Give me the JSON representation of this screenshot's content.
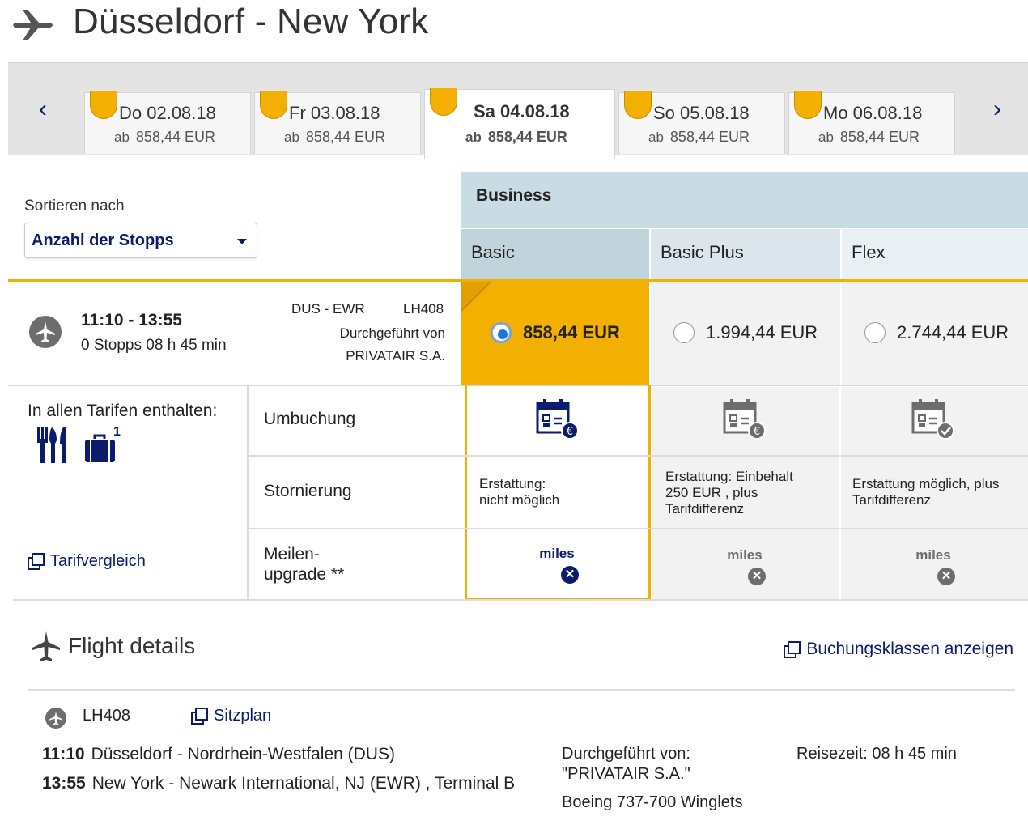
{
  "header": {
    "title": "Düsseldorf - New York"
  },
  "date_tabs": [
    {
      "date": "Do 02.08.18",
      "ab": "ab",
      "price": "858,44 EUR",
      "selected": false
    },
    {
      "date": "Fr 03.08.18",
      "ab": "ab",
      "price": "858,44 EUR",
      "selected": false
    },
    {
      "date": "Sa 04.08.18",
      "ab": "ab",
      "price": "858,44 EUR",
      "selected": true
    },
    {
      "date": "So 05.08.18",
      "ab": "ab",
      "price": "858,44 EUR",
      "selected": false
    },
    {
      "date": "Mo 06.08.18",
      "ab": "ab",
      "price": "858,44 EUR",
      "selected": false
    }
  ],
  "nav": {
    "prev": "‹",
    "next": "›"
  },
  "sort": {
    "label": "Sortieren nach",
    "value": "Anzahl der Stopps"
  },
  "cabin": {
    "name": "Business",
    "fares": [
      "Basic",
      "Basic Plus",
      "Flex"
    ]
  },
  "flight": {
    "times": "11:10 - 13:55",
    "stops_duration": "0 Stopps 08 h 45 min",
    "route": "DUS - EWR",
    "flight_number": "LH408",
    "operated_label": "Durchgeführt von",
    "operator": "PRIVATAIR S.A.",
    "prices": [
      {
        "fare": "Basic",
        "price": "858,44 EUR",
        "selected": true
      },
      {
        "fare": "Basic Plus",
        "price": "1.994,44 EUR",
        "selected": false
      },
      {
        "fare": "Flex",
        "price": "2.744,44 EUR",
        "selected": false
      }
    ]
  },
  "included": {
    "label": "In allen Tarifen enthalten:",
    "baggage_count": "1",
    "compare_link": "Tarifvergleich"
  },
  "conditions": {
    "rebooking_label": "Umbuchung",
    "cancellation_label": "Stornierung",
    "upgrade_label_line1": "Meilen-",
    "upgrade_label_line2": "upgrade **",
    "cancellation": [
      [
        "Erstattung:",
        "nicht möglich"
      ],
      [
        "Erstattung: Einbehalt",
        "250 EUR , plus",
        "Tarifdifferenz"
      ],
      [
        "Erstattung möglich, plus",
        "Tarifdifferenz"
      ]
    ],
    "miles_label": "miles"
  },
  "details": {
    "title": "Flight details",
    "booking_classes_link": "Buchungsklassen anzeigen",
    "segment": {
      "flight_number": "LH408",
      "seatmap_link": "Sitzplan",
      "dep_time": "11:10",
      "dep_place": "Düsseldorf - Nordrhein-Westfalen (DUS)",
      "arr_time": "13:55",
      "arr_place": "New York - Newark International, NJ (EWR) , Terminal B",
      "operated_label": "Durchgeführt von:",
      "operator": "\"PRIVATAIR S.A.\"",
      "aircraft": "Boeing 737-700 Winglets",
      "travel_time": "Reisezeit: 08 h 45 min"
    }
  },
  "colors": {
    "navy": "#0a1c6b",
    "gold": "#f4b000",
    "blue_radio": "#1b74e4",
    "cabin_bg": "#c9dbe3"
  }
}
